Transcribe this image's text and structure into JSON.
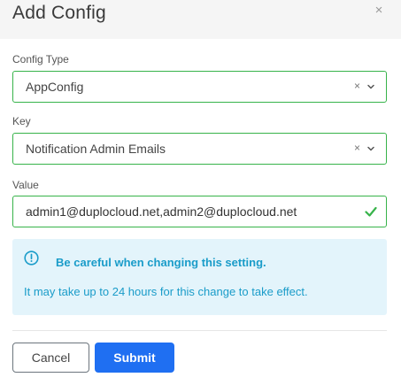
{
  "modal": {
    "title": "Add Config",
    "close_label": "×"
  },
  "form": {
    "config_type": {
      "label": "Config Type",
      "value": "AppConfig",
      "clear_label": "×"
    },
    "key": {
      "label": "Key",
      "value": "Notification Admin Emails",
      "clear_label": "×"
    },
    "value": {
      "label": "Value",
      "value": "admin1@duplocloud.net,admin2@duplocloud.net"
    }
  },
  "alert": {
    "title": "Be careful when changing this setting.",
    "body": "It may take up to 24 hours for this change to take effect.",
    "color": "#1a9cc9",
    "background": "#e3f4fb"
  },
  "actions": {
    "cancel_label": "Cancel",
    "submit_label": "Submit"
  },
  "colors": {
    "valid_border": "#37b34a",
    "primary": "#1f6ff2"
  }
}
